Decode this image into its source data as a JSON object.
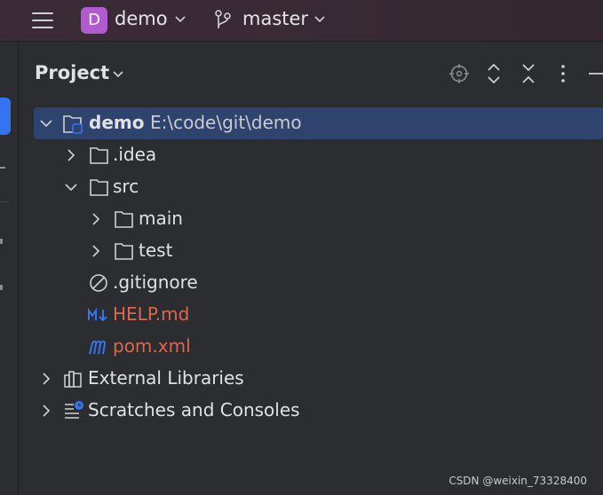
{
  "titlebar": {
    "project_badge": "D",
    "project_name": "demo",
    "branch_name": "master"
  },
  "panel": {
    "title": "Project"
  },
  "tree": {
    "root_name": "demo",
    "root_path": "E:\\code\\git\\demo",
    "idea": ".idea",
    "src": "src",
    "main": "main",
    "test": "test",
    "gitignore": ".gitignore",
    "help_md": "HELP.md",
    "pom": "pom.xml",
    "external_libraries": "External Libraries",
    "scratches": "Scratches and Consoles"
  },
  "colors": {
    "accent": "#3574f0",
    "selection": "#2e436e",
    "vcs_untracked": "#d9684f",
    "badge": "#b05bd0"
  },
  "watermark": "CSDN @weixin_73328400"
}
